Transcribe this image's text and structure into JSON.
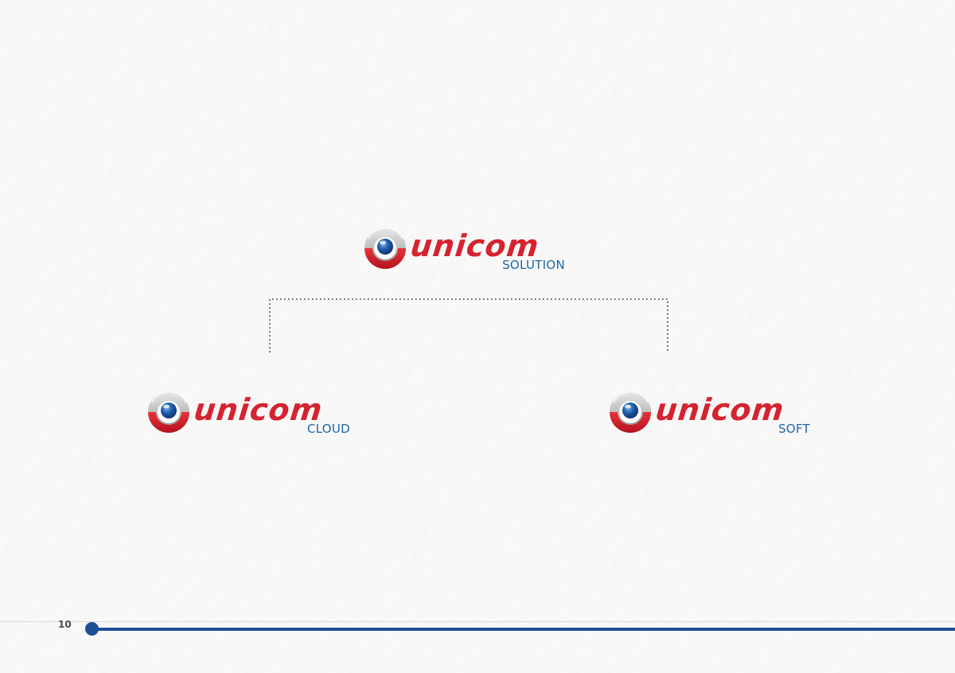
{
  "brand": {
    "name": "unicom",
    "red": "#d5232f",
    "blue": "#1e67a8"
  },
  "logos": {
    "solution": {
      "wordmark": "unicom",
      "sub": "SOLUTION"
    },
    "cloud": {
      "wordmark": "unicom",
      "sub": "CLOUD"
    },
    "soft": {
      "wordmark": "unicom",
      "sub": "SOFT"
    }
  },
  "footer": {
    "page_number": "10",
    "line_color": "#1f4f95"
  }
}
